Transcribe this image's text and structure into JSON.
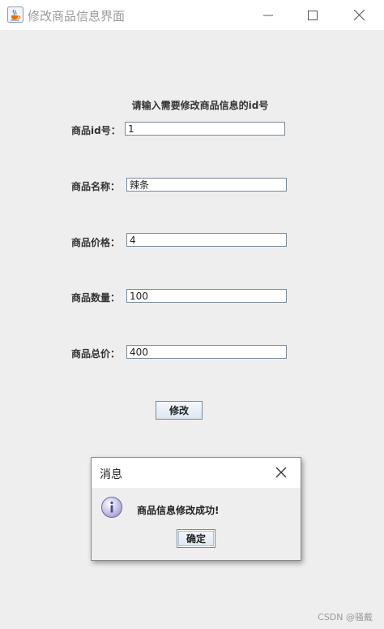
{
  "window": {
    "title": "修改商品信息界面",
    "icon": "java-coffee-cup-icon"
  },
  "form": {
    "prompt": "请输入需要修改商品信息的id号",
    "id_label": "商品id号：",
    "id_value": "1",
    "name_label": "商品名称：",
    "name_value": "辣条",
    "price_label": "商品价格：",
    "price_value": "4",
    "quantity_label": "商品数量：",
    "quantity_value": "100",
    "total_label": "商品总价：",
    "total_value": "400",
    "submit_label": "修改"
  },
  "dialog": {
    "title": "消息",
    "message": "商品信息修改成功!",
    "ok_label": "确定",
    "icon": "info-icon"
  },
  "watermark": "CSDN @骚戴"
}
